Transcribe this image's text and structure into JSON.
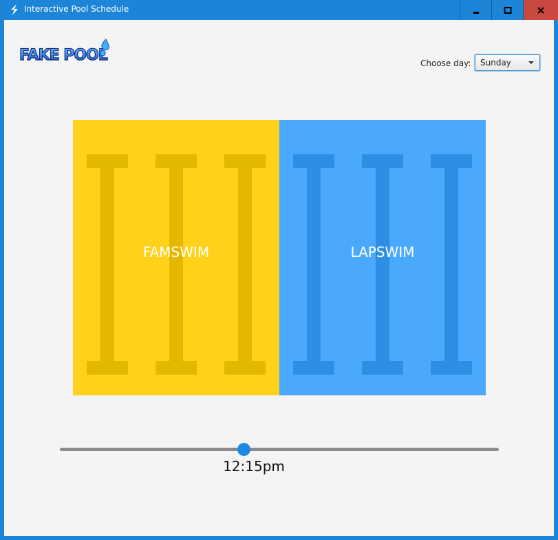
{
  "window": {
    "title": "Interactive Pool Schedule",
    "accent_color": "#1c85d8",
    "close_color": "#c9483f"
  },
  "logo": {
    "text": "FAKE POOL"
  },
  "day_picker": {
    "label": "Choose day:",
    "selected": "Sunday"
  },
  "pool": {
    "zones": [
      {
        "label": "FAMSWIM",
        "color": "#ffd11a",
        "lane_color": "#e4b800"
      },
      {
        "label": "LAPSWIM",
        "color": "#4aa9fc",
        "lane_color": "#2d8ee3"
      }
    ]
  },
  "time_slider": {
    "value_label": "12:15pm",
    "fraction": 0.42
  }
}
